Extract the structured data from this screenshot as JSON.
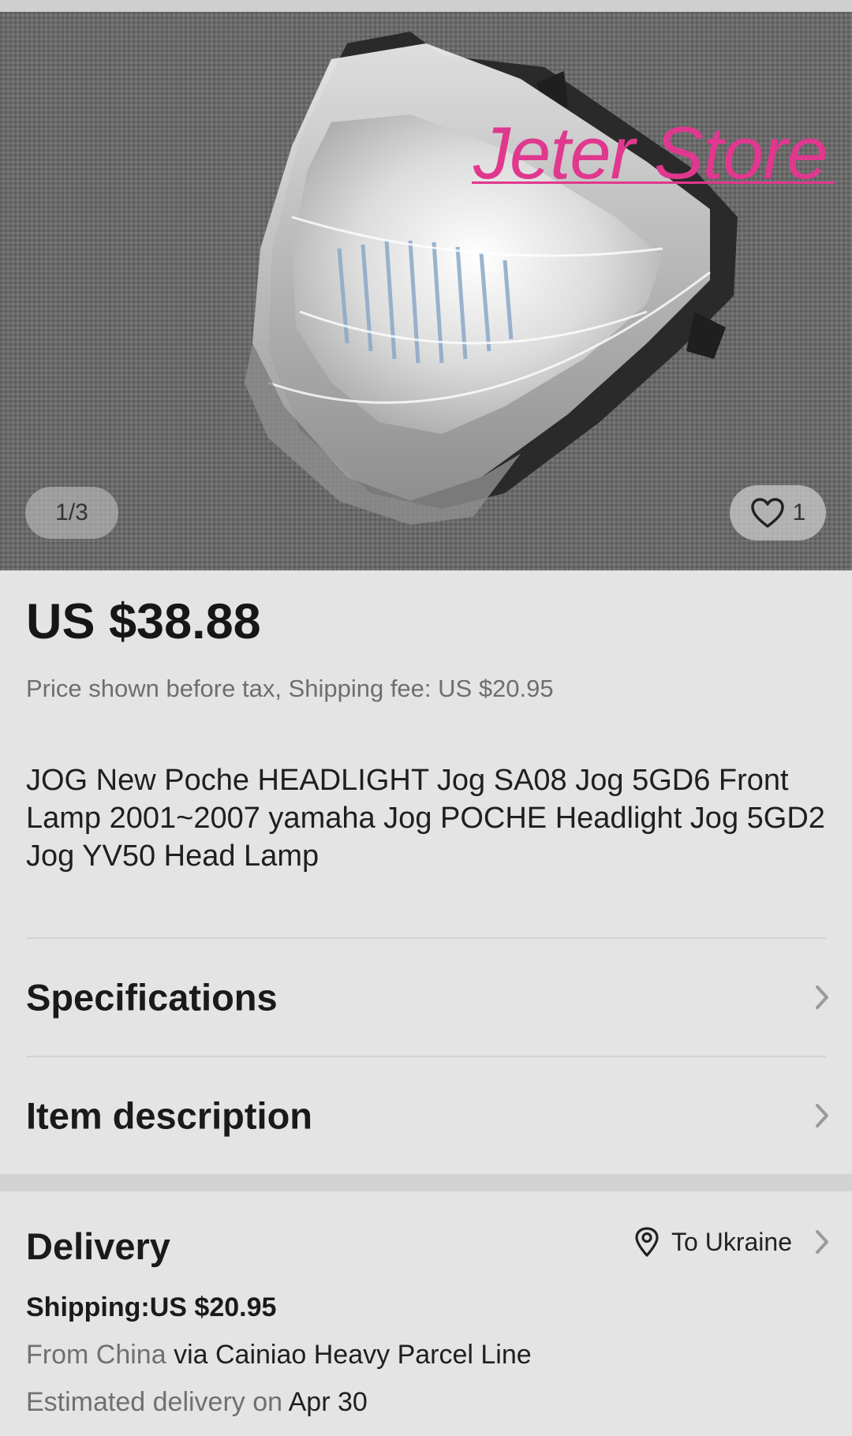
{
  "gallery": {
    "watermark": "Jeter Store",
    "counter": "1/3",
    "favorites_count": "1"
  },
  "product": {
    "price": "US $38.88",
    "price_note": "Price shown before tax, Shipping fee: US $20.95",
    "title": "JOG New Poche HEADLIGHT Jog SA08 Jog 5GD6 Front Lamp 2001~2007 yamaha Jog POCHE Headlight Jog 5GD2 Jog YV50 Head Lamp"
  },
  "sections": {
    "specifications": "Specifications",
    "item_description": "Item description"
  },
  "delivery": {
    "title": "Delivery",
    "destination": "To Ukraine",
    "shipping": "Shipping:US $20.95",
    "from_prefix": "From",
    "from_country": "China",
    "via_prefix": "via",
    "carrier": "Cainiao Heavy Parcel Line",
    "eta_prefix": "Estimated delivery on",
    "eta_date": "Apr 30"
  },
  "icons": {
    "favorite": "heart-icon",
    "chevron": "chevron-right-icon",
    "location": "map-pin-icon"
  }
}
